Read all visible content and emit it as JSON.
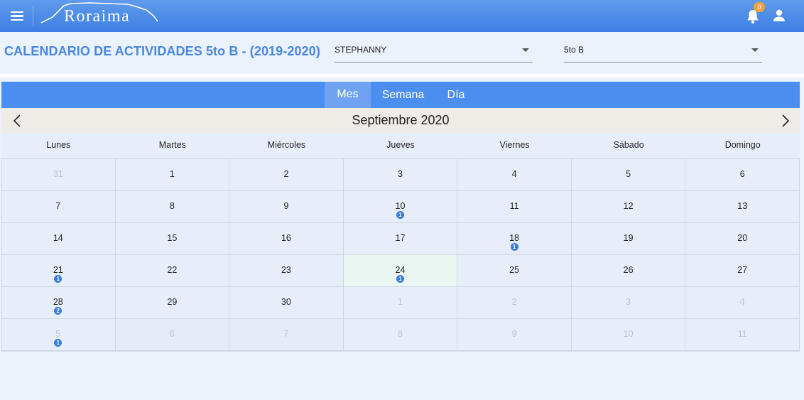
{
  "app": {
    "logo_text": "Roraima",
    "notification_count": "0"
  },
  "header": {
    "title": "CALENDARIO DE ACTIVIDADES 5to B - (2019-2020)",
    "student_select": "STEPHANNY",
    "section_select": "5to B"
  },
  "calendar": {
    "views": [
      "Mes",
      "Semana",
      "Día"
    ],
    "active_view": "Mes",
    "month_title": "Septiembre 2020",
    "weekdays": [
      "Lunes",
      "Martes",
      "Miércoles",
      "Jueves",
      "Viernes",
      "Sábado",
      "Domingo"
    ],
    "weeks": [
      [
        {
          "d": "31",
          "o": true
        },
        {
          "d": "1"
        },
        {
          "d": "2"
        },
        {
          "d": "3"
        },
        {
          "d": "4"
        },
        {
          "d": "5"
        },
        {
          "d": "6"
        }
      ],
      [
        {
          "d": "7"
        },
        {
          "d": "8"
        },
        {
          "d": "9"
        },
        {
          "d": "10",
          "e": "1"
        },
        {
          "d": "11"
        },
        {
          "d": "12"
        },
        {
          "d": "13"
        }
      ],
      [
        {
          "d": "14"
        },
        {
          "d": "15"
        },
        {
          "d": "16"
        },
        {
          "d": "17"
        },
        {
          "d": "18",
          "e": "1"
        },
        {
          "d": "19"
        },
        {
          "d": "20"
        }
      ],
      [
        {
          "d": "21",
          "e": "1"
        },
        {
          "d": "22"
        },
        {
          "d": "23"
        },
        {
          "d": "24",
          "e": "1",
          "today": true
        },
        {
          "d": "25"
        },
        {
          "d": "26"
        },
        {
          "d": "27"
        }
      ],
      [
        {
          "d": "28",
          "e": "2"
        },
        {
          "d": "29"
        },
        {
          "d": "30"
        },
        {
          "d": "1",
          "o": true
        },
        {
          "d": "2",
          "o": true
        },
        {
          "d": "3",
          "o": true
        },
        {
          "d": "4",
          "o": true
        }
      ],
      [
        {
          "d": "5",
          "o": true,
          "e": "1"
        },
        {
          "d": "6",
          "o": true
        },
        {
          "d": "7",
          "o": true
        },
        {
          "d": "8",
          "o": true
        },
        {
          "d": "9",
          "o": true
        },
        {
          "d": "10",
          "o": true
        },
        {
          "d": "11",
          "o": true
        }
      ]
    ]
  },
  "colors": {
    "topbar": "#3d7fe3",
    "title": "#4a86e0",
    "view_bar": "#4a8ef0",
    "event_badge": "#3a7bd5",
    "notification_badge": "#f2a23c"
  },
  "icons": {
    "menu": "menu-icon",
    "bell": "bell-icon",
    "user": "user-icon",
    "prev": "chevron-left-icon",
    "next": "chevron-right-icon"
  }
}
